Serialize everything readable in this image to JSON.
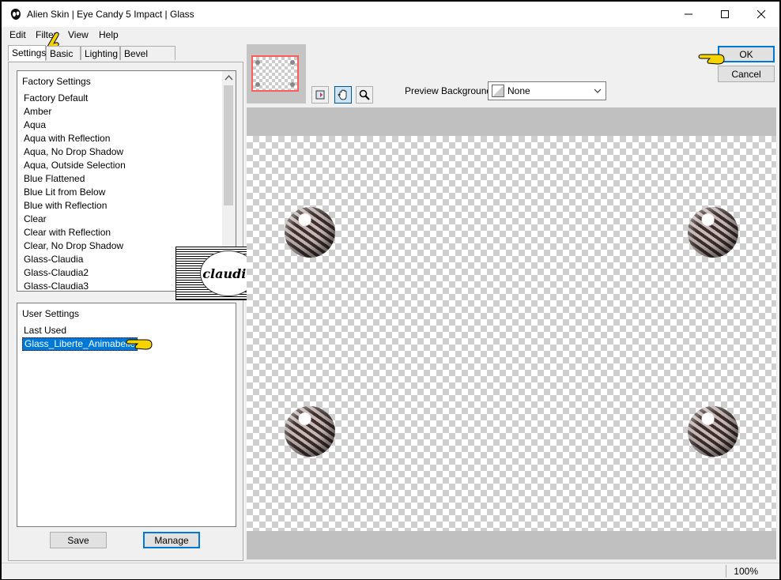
{
  "window": {
    "title": "Alien Skin | Eye Candy 5 Impact | Glass"
  },
  "menu": [
    "Edit",
    "Filter",
    "View",
    "Help"
  ],
  "tabs": [
    "Settings",
    "Basic",
    "Lighting",
    "Bevel Profile"
  ],
  "factory_settings": {
    "header": "Factory Settings",
    "items": [
      "Factory Default",
      "Amber",
      "Aqua",
      "Aqua with Reflection",
      "Aqua, No Drop Shadow",
      "Aqua, Outside Selection",
      "Blue Flattened",
      "Blue Lit from Below",
      "Blue with Reflection",
      "Clear",
      "Clear with Reflection",
      "Clear, No Drop Shadow",
      "Glass-Claudia",
      "Glass-Claudia2",
      "Glass-Claudia3"
    ]
  },
  "user_settings": {
    "header": "User Settings",
    "items": [
      "Last Used",
      "Glass_Liberte_Animabelle"
    ],
    "selected_index": 1
  },
  "buttons": {
    "save": "Save",
    "manage": "Manage",
    "ok": "OK",
    "cancel": "Cancel"
  },
  "preview_background": {
    "label": "Preview Background:",
    "value": "None"
  },
  "status": {
    "zoom": "100%"
  },
  "watermark": {
    "text": "claudia"
  },
  "colors": {
    "selection": "#0078d7",
    "thumbnail_border": "#ff5b5b",
    "pointer_hand": "#f5d400"
  }
}
